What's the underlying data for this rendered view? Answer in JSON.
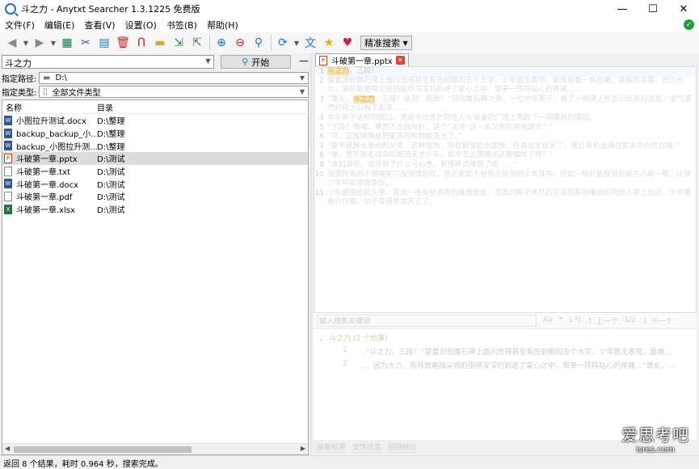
{
  "window": {
    "title": "斗之力 - Anytxt Searcher 1.3.1225 免费版"
  },
  "menu": [
    "文件(F)",
    "编辑(E)",
    "查看(V)",
    "设置(O)",
    "书签(B)",
    "帮助(H)"
  ],
  "toolbar": {
    "icons": [
      "back-arrow-icon",
      "dropdown-icon",
      "forward-arrow-icon",
      "dropdown-icon",
      "excel-icon",
      "cut-icon",
      "document-icon",
      "delete-icon",
      "magnet-icon",
      "folder-icon",
      "export-icon",
      "import-icon",
      "zoom-in-icon",
      "zoom-out-icon",
      "search-icon",
      "refresh-icon",
      "dropdown-icon",
      "translate-icon",
      "star-icon",
      "heart-icon"
    ],
    "precise_search": "精准搜索"
  },
  "search": {
    "query": "斗之力",
    "start_label": "开始"
  },
  "path": {
    "label": "指定路径:",
    "value": "D:\\"
  },
  "filetype": {
    "label": "指定类型:",
    "value": "全部文件类型"
  },
  "list": {
    "headers": [
      "名称",
      "目录"
    ],
    "rows": [
      {
        "name": "小图拉升测试.docx",
        "dir": "D:\\整理",
        "type": "docx"
      },
      {
        "name": "backup_backup_小...",
        "dir": "D:\\整理",
        "type": "docx"
      },
      {
        "name": "backup_小图拉升测...",
        "dir": "D:\\整理",
        "type": "docx"
      },
      {
        "name": "斗破第一章.pptx",
        "dir": "D:\\测试",
        "type": "pptx"
      },
      {
        "name": "斗破第一章.txt",
        "dir": "D:\\测试",
        "type": "txt"
      },
      {
        "name": "斗破第一章.docx",
        "dir": "D:\\测试",
        "type": "docx"
      },
      {
        "name": "斗破第一章.pdf",
        "dir": "D:\\测试",
        "type": "pdf"
      },
      {
        "name": "斗破第一章.xlsx",
        "dir": "D:\\测试",
        "type": "xlsx"
      }
    ]
  },
  "preview": {
    "tab_label": "斗破第一章.pptx",
    "lines": [
      {
        "n": "1",
        "pre": "",
        "hl": "斗之力",
        "post": "，三段！"
      },
      {
        "n": "2",
        "pre": "望着测验魔石碑上面闪亮得甚至有些刺眼的五个大字，少年面无表情，唇角有着一抹自嘲，紧握的手掌，因为大力，而导致略微尖锐的指甲深深的刺进了掌心之中，带来一阵阵钻心的疼痛……",
        "hl": "",
        "post": ""
      },
      {
        "n": "3",
        "pre": "“萧炎，",
        "hl": "斗之力",
        "post": "，三段！级别：低级！”测验魔石碑之旁，一位中年男子，看了一眼碑上所显示出来的信息，语气漠然的将之公布了出来……"
      },
      {
        "n": "4",
        "pre": "中年男子话刚刚脱口，便是不出意外的在人头汹涌的广场上带起了一阵嘲讽的骚动。",
        "hl": "",
        "post": ""
      },
      {
        "n": "5",
        "pre": "“三段？嘿嘿，果然不出我所料，这个“天才”这一年又是在原地踏步！”",
        "hl": "",
        "post": ""
      },
      {
        "n": "6",
        "pre": "“哎，这废物真是把家族的脸都给丢光了。”",
        "hl": "",
        "post": ""
      },
      {
        "n": "7",
        "pre": "“要不是族长是他的父亲，这种废物，早就被驱赶出家族，任其自生自灭了，哪还有机会待在家族中白吃白喝。”",
        "hl": "",
        "post": ""
      },
      {
        "n": "8",
        "pre": "“唉，昔年那名闻乌坦城的天才少年，如今怎么落魄成这般模样了啊？”",
        "hl": "",
        "post": ""
      },
      {
        "n": "9",
        "pre": "“谁知道呢，或许做了什么亏心事，惹得神灵降怒了吧……”",
        "hl": "",
        "post": ""
      },
      {
        "n": "10",
        "pre": "周围传来的不屑嘲笑以及惋惜轻叹，落在那如木桩待在原地的少年耳中，恍如一根利刺狠狠的刺在心脏一般，让得少年呼吸微微急促。",
        "hl": "",
        "post": ""
      },
      {
        "n": "11",
        "pre": "少年缓缓抬起头来，露出一张有些清秀的稚嫩脸庞，漆黑的眸子木然的在周围那些嘲讽的同龄人身上扫过，少年嘴角的自嘲，似乎变得更加苦涩了。",
        "hl": "",
        "post": ""
      }
    ]
  },
  "find": {
    "placeholder": "输入搜索关键词",
    "opts": [
      "Aa",
      "❝",
      "(.*)",
      "上一个",
      "1/2",
      "下一个"
    ]
  },
  "results": {
    "group": "斗之力 (2 个结果)",
    "items": [
      {
        "n": "1",
        "text": "…“斗之力，三段！”望着测验魔石碑上面闪亮得甚至有些刺眼的五个大字，少年面无表情，唇角…"
      },
      {
        "n": "2",
        "text": "…，因为大力，而导致略微尖锐的指甲深深的刺进了掌心之中，带来一阵阵钻心的疼痛…“萧炎，…"
      }
    ]
  },
  "bottom_tabs": [
    "搜索结果",
    "文件信息",
    "回顾统计"
  ],
  "status": "返回 8 个结果，耗时 0.964 秒，搜索完成。",
  "watermark": {
    "big": "爱思考吧",
    "small": "isres.com"
  },
  "colors": {
    "accent": "#1a73c8",
    "ok": "#1e9e3a"
  }
}
